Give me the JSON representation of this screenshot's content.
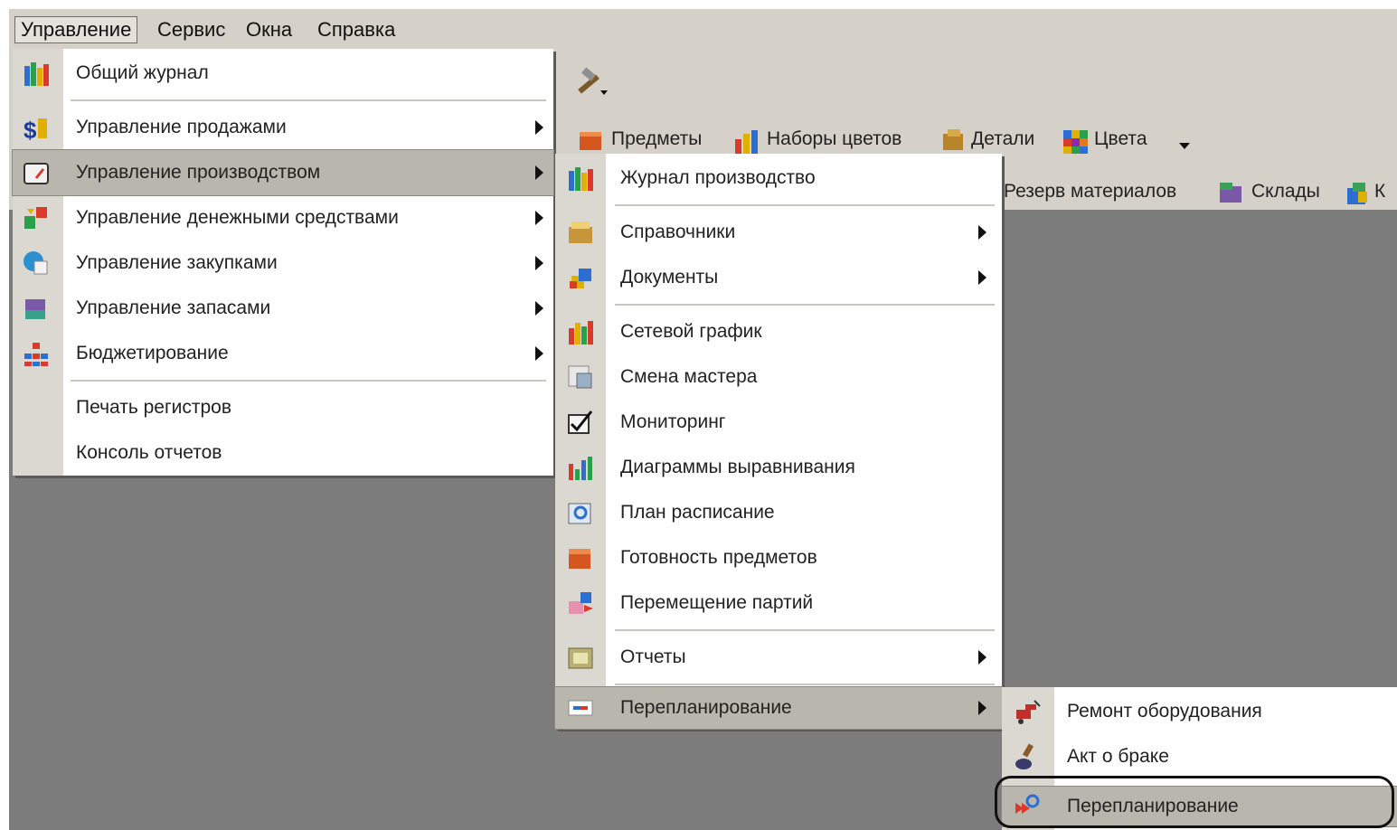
{
  "menubar": {
    "items": [
      "Управление",
      "Сервис",
      "Окна",
      "Справка"
    ]
  },
  "toolbar": {
    "row2": [
      "Предметы",
      "Наборы цветов",
      "Детали",
      "Цвета"
    ],
    "row3": [
      "Резерв материалов",
      "Склады",
      "К"
    ]
  },
  "menu_main": {
    "items": [
      {
        "label": "Общий журнал",
        "icon": "books-icon"
      },
      {
        "label": "Управление продажами",
        "icon": "sales-icon"
      },
      {
        "label": "Управление производством",
        "icon": "gauge-icon"
      },
      {
        "label": "Управление денежными средствами",
        "icon": "money-icon"
      },
      {
        "label": "Управление закупками",
        "icon": "purchase-icon"
      },
      {
        "label": "Управление запасами",
        "icon": "stock-icon"
      },
      {
        "label": "Бюджетирование",
        "icon": "budget-icon"
      },
      {
        "label": "Печать регистров",
        "icon": ""
      },
      {
        "label": "Консоль отчетов",
        "icon": ""
      }
    ]
  },
  "menu_production": {
    "items": [
      {
        "label": "Журнал производство",
        "icon": "books-icon"
      },
      {
        "label": "Справочники",
        "icon": "catalog-icon"
      },
      {
        "label": "Документы",
        "icon": "documents-icon"
      },
      {
        "label": "Сетевой график",
        "icon": "network-chart-icon"
      },
      {
        "label": "Смена мастера",
        "icon": "shift-icon"
      },
      {
        "label": "Мониторинг",
        "icon": "monitoring-icon"
      },
      {
        "label": "Диаграммы выравнивания",
        "icon": "bar-chart-icon"
      },
      {
        "label": "План расписание",
        "icon": "schedule-icon"
      },
      {
        "label": "Готовность предметов",
        "icon": "readiness-icon"
      },
      {
        "label": "Перемещение партий",
        "icon": "transfer-icon"
      },
      {
        "label": "Отчеты",
        "icon": "reports-icon"
      },
      {
        "label": "Перепланирование",
        "icon": "replan-icon"
      }
    ]
  },
  "menu_replan": {
    "items": [
      {
        "label": "Ремонт оборудования",
        "icon": "repair-icon"
      },
      {
        "label": "Акт о браке",
        "icon": "stamp-icon"
      },
      {
        "label": "Перепланирование",
        "icon": "replan-run-icon"
      }
    ]
  },
  "colors": {
    "menu_bg": "#ffffff",
    "gutter": "#dbd8d1",
    "selected": "#b9b6ad",
    "workspace": "#7c7c7c",
    "chrome": "#d5d1c8"
  }
}
